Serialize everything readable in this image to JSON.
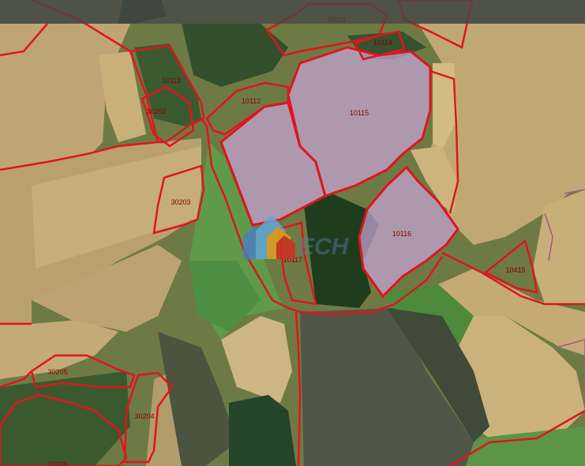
{
  "map": {
    "boundary_color": "#e0151d",
    "plot_fill_color": "#c8a4d6",
    "labels": {
      "p10111": "10111",
      "p10114": "10114",
      "p10113": "10113",
      "p10112": "10112",
      "p10115": "10115",
      "p30202": "30202",
      "p30203": "30203",
      "p10116": "10116",
      "p10117": "10117",
      "p10415": "10415",
      "p30205": "30205",
      "p30204": "30204",
      "p30206": "30206"
    },
    "watermark": {
      "text": "ЕСН"
    }
  }
}
